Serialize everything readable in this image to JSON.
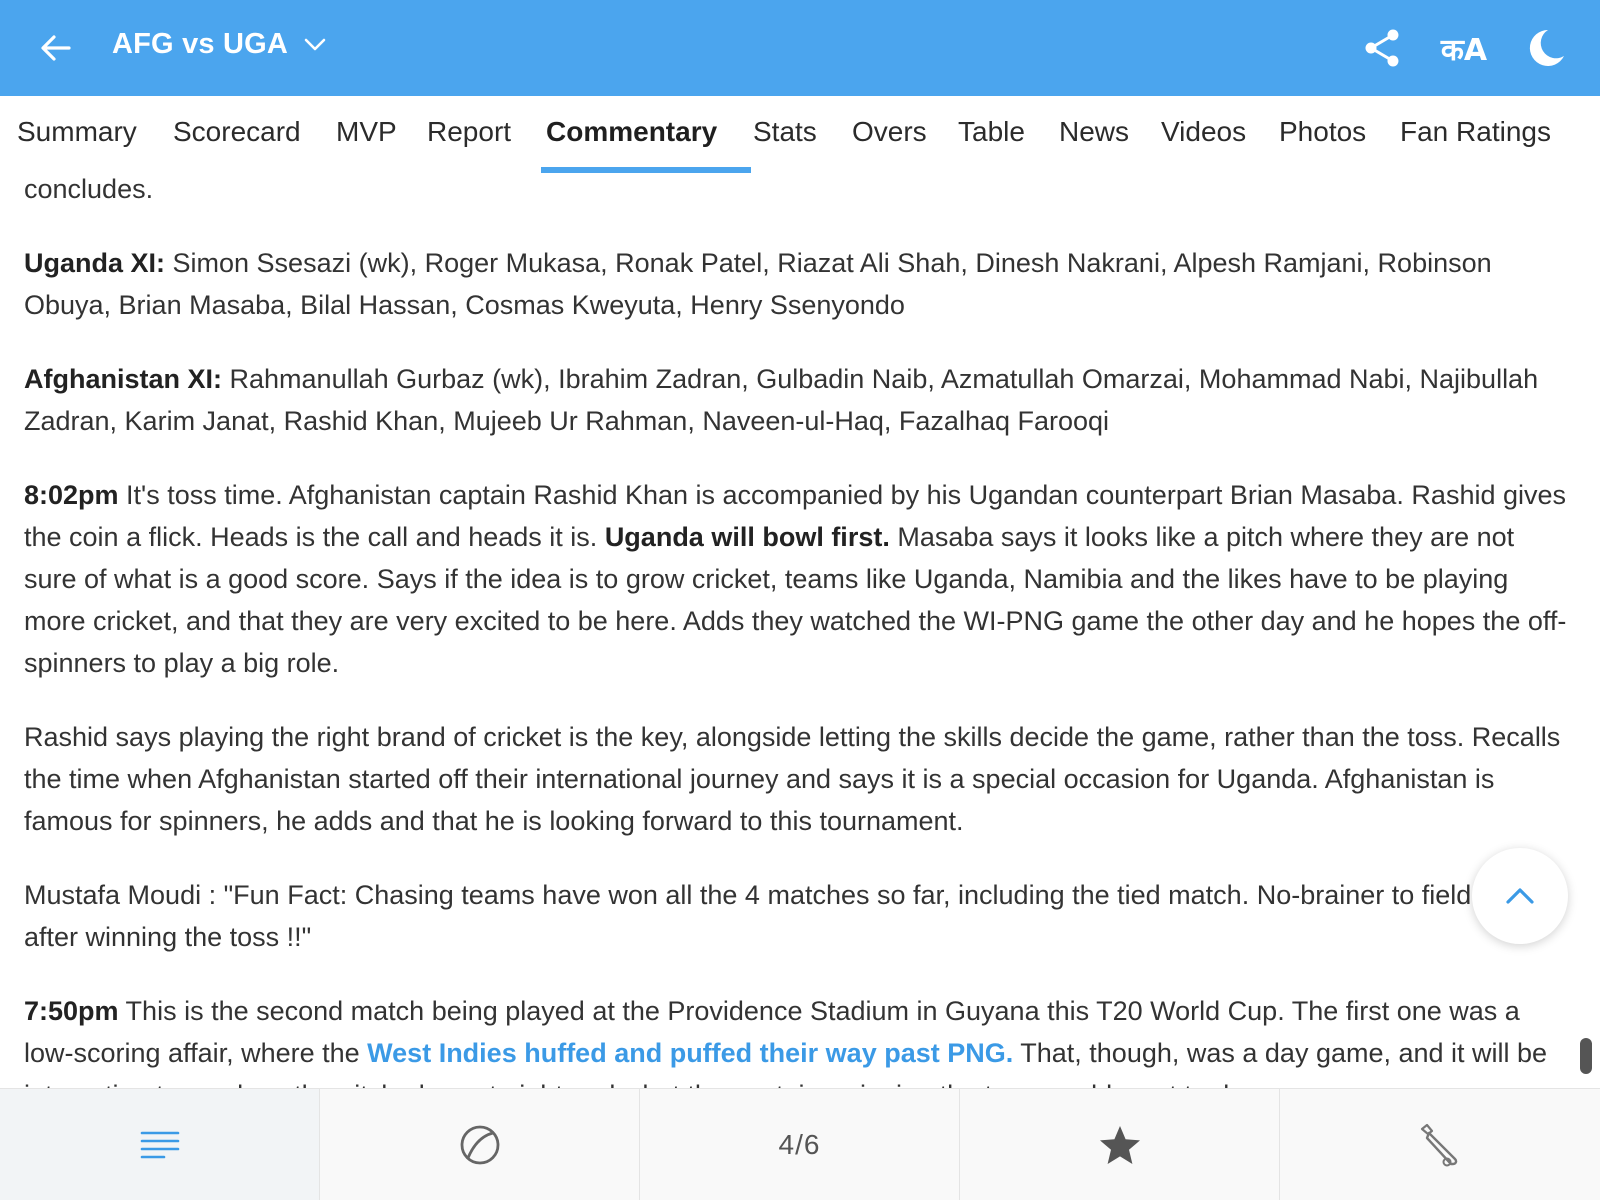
{
  "header": {
    "title": "AFG vs UGA",
    "back_icon": "arrow-left-icon",
    "title_dropdown_icon": "chevron-down-icon",
    "share_icon": "share-icon",
    "language_label": "कA",
    "dark_mode_icon": "moon-icon",
    "background_color": "#4ba5ee"
  },
  "tabs": [
    {
      "label": "Summary",
      "active": false
    },
    {
      "label": "Scorecard",
      "active": false
    },
    {
      "label": "MVP",
      "active": false
    },
    {
      "label": "Report",
      "active": false
    },
    {
      "label": "Commentary",
      "active": true
    },
    {
      "label": "Stats",
      "active": false
    },
    {
      "label": "Overs",
      "active": false
    },
    {
      "label": "Table",
      "active": false
    },
    {
      "label": "News",
      "active": false
    },
    {
      "label": "Videos",
      "active": false
    },
    {
      "label": "Photos",
      "active": false
    },
    {
      "label": "Fan Ratings",
      "active": false
    }
  ],
  "commentary": {
    "p0": "concludes.",
    "p1_label": "Uganda XI:",
    "p1_text": " Simon Ssesazi (wk), Roger Mukasa, Ronak Patel, Riazat Ali Shah, Dinesh Nakrani, Alpesh Ramjani, Robinson Obuya, Brian Masaba, Bilal Hassan, Cosmas Kweyuta, Henry Ssenyondo",
    "p2_label": "Afghanistan XI:",
    "p2_text": " Rahmanullah Gurbaz (wk), Ibrahim Zadran, Gulbadin Naib, Azmatullah Omarzai, Mohammad Nabi, Najibullah Zadran, Karim Janat, Rashid Khan, Mujeeb Ur Rahman, Naveen-ul-Haq, Fazalhaq Farooqi",
    "p3_time": "8:02pm",
    "p3_text_a": " It's toss time. Afghanistan captain Rashid Khan is accompanied by his Ugandan counterpart Brian Masaba. Rashid gives the coin a flick. Heads is the call and heads it is. ",
    "p3_bold": "Uganda will bowl first.",
    "p3_text_b": " Masaba says it looks like a pitch where they are not sure of what is a good score. Says if the idea is to grow cricket, teams like Uganda, Namibia and the likes have to be playing more cricket, and that they are very excited to be here. Adds they watched the WI-PNG game the other day and he hopes the off-spinners to play a big role.",
    "p4": "Rashid says playing the right brand of cricket is the key, alongside letting the skills decide the game, rather than the toss. Recalls the time when Afghanistan started off their international journey and says it is a special occasion for Uganda. Afghanistan is famous for spinners, he adds and that he is looking forward to this tournament.",
    "p5": "Mustafa Moudi : \"Fun Fact: Chasing teams have won all the 4 matches so far, including the tied match. No-brainer to field first after winning the toss !!\"",
    "p6_time": "7:50pm",
    "p6_text_a": " This is the second match being played at the Providence Stadium in Guyana this T20 World Cup. The first one was a low-scoring affair, where the ",
    "p6_link": "West Indies huffed and puffed their way past PNG.",
    "p6_text_b": " That, though, was a day game, and it will be interesting to see how the pitch plays at night and what the captains winning the toss would want to do."
  },
  "scroll_top_icon": "chevron-up-icon",
  "bottom_bar": {
    "menu_icon": "menu-lines-icon",
    "ball_icon": "cricket-ball-icon",
    "page_indicator": "4/6",
    "star_icon": "star-icon",
    "bat_icon": "cricket-bat-icon"
  },
  "colors": {
    "accent": "#4ba5ee",
    "link": "#3b9ae6"
  }
}
